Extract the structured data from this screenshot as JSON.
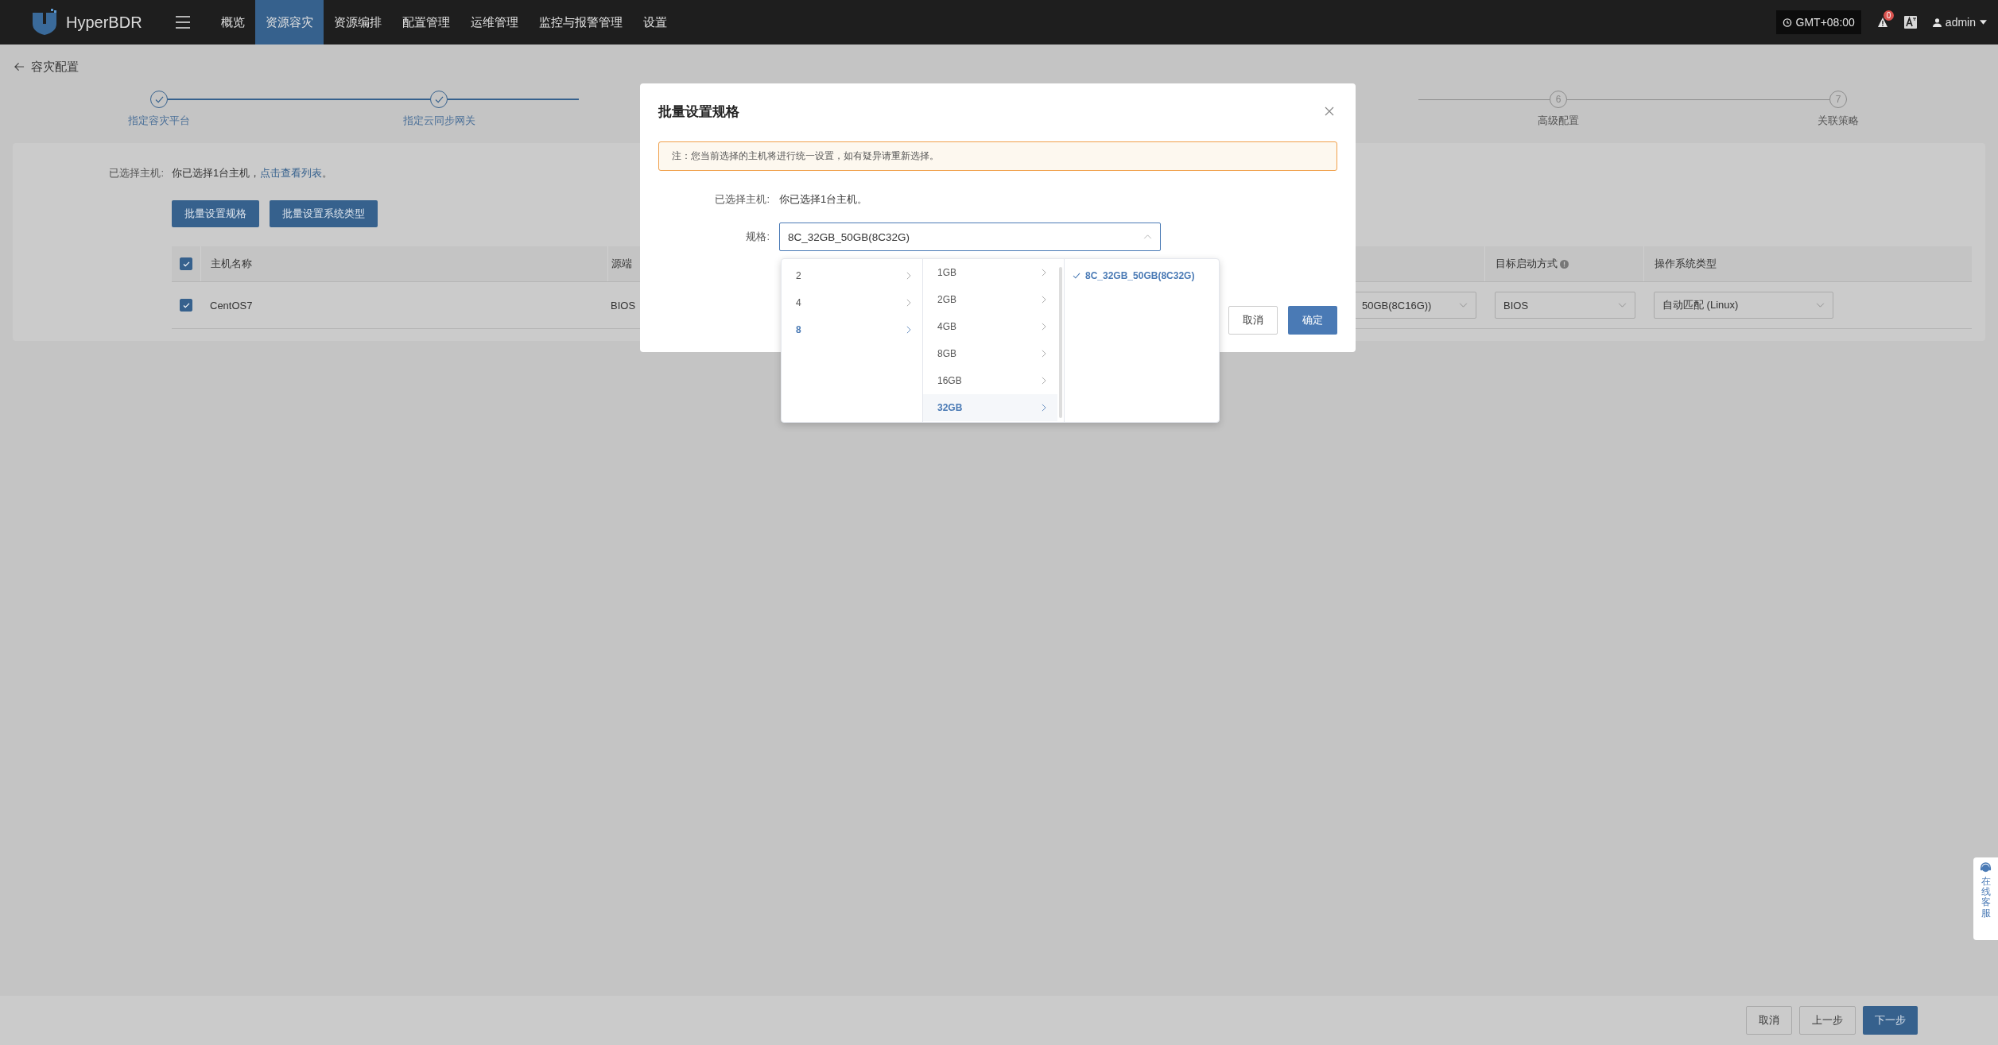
{
  "topbar": {
    "brand": "HyperBDR",
    "nav": [
      {
        "label": "概览",
        "selected": false
      },
      {
        "label": "资源容灾",
        "selected": true
      },
      {
        "label": "资源编排",
        "selected": false
      },
      {
        "label": "配置管理",
        "selected": false
      },
      {
        "label": "运维管理",
        "selected": false
      },
      {
        "label": "监控与报警管理",
        "selected": false
      },
      {
        "label": "设置",
        "selected": false
      }
    ],
    "timezone": "GMT+08:00",
    "alert_count": "0",
    "user": "admin"
  },
  "page_title": "容灾配置",
  "steps": [
    {
      "label": "指定容灾平台",
      "completed": true
    },
    {
      "label": "指定云同步网关",
      "completed": true
    },
    {
      "number": "6",
      "label": "高级配置",
      "completed": false
    },
    {
      "number": "7",
      "label": "关联策略",
      "completed": false
    }
  ],
  "selection": {
    "label": "已选择主机:",
    "text": "你已选择1台主机，",
    "link": "点击查看列表",
    "end": "。"
  },
  "batch_buttons": [
    "批量设置规格",
    "批量设置系统类型"
  ],
  "table": {
    "all_checked": true,
    "columns": [
      "主机名称",
      "源端",
      "目标启动方式",
      "操作系统类型"
    ],
    "rows": [
      {
        "checked": true,
        "host_name": "CentOS7",
        "column_2": "BIOS",
        "column_3": "50GB(8C16G))",
        "target_boot": "BIOS",
        "os_type": "自动匹配 (Linux)"
      }
    ]
  },
  "modal": {
    "title": "批量设置规格",
    "notice": "注：您当前选择的主机将进行统一设置，如有疑异请重新选择。",
    "selected_label": "已选择主机:",
    "selected_text": "你已选择1台主机。",
    "spec_label": "规格:",
    "spec_value": "8C_32GB_50GB(8C32G)",
    "cascader": [
      {
        "options": [
          {
            "label": "2",
            "selected": false
          },
          {
            "label": "4",
            "selected": false
          },
          {
            "label": "8",
            "selected": true
          }
        ]
      },
      {
        "options": [
          {
            "label": "1GB",
            "selected": false
          },
          {
            "label": "2GB",
            "selected": false
          },
          {
            "label": "4GB",
            "selected": false
          },
          {
            "label": "8GB",
            "selected": false
          },
          {
            "label": "16GB",
            "selected": false
          },
          {
            "label": "32GB",
            "selected": true
          }
        ]
      },
      {
        "options": [
          {
            "label": "8C_32GB_50GB(8C32G)",
            "selected": true
          }
        ]
      }
    ],
    "buttons": [
      {
        "label": "取消",
        "kind": "default"
      },
      {
        "label": "确定",
        "kind": "primary"
      }
    ]
  },
  "footer": {
    "buttons": [
      {
        "label": "取消",
        "kind": "default"
      },
      {
        "label": "上一步",
        "kind": "default"
      },
      {
        "label": "下一步",
        "kind": "primary"
      }
    ]
  },
  "support": {
    "label": "在线客服"
  }
}
